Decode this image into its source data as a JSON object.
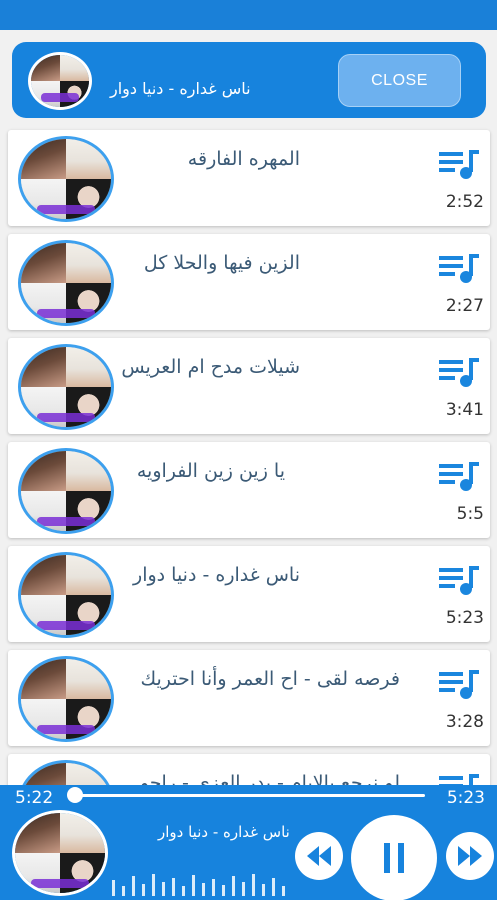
{
  "colors": {
    "brand": "#1783dd",
    "accent": "#3da0ee",
    "text": "#3b5a76"
  },
  "header": {
    "now_playing_title": "ناس غداره - دنيا دوار",
    "close_label": "CLOSE"
  },
  "songs": [
    {
      "title": "المهره الفارقه",
      "duration": "2:52"
    },
    {
      "title": "الزين فيها والحلا كل",
      "duration": "2:27"
    },
    {
      "title": "شيلات مدح ام العريس",
      "duration": "3:41"
    },
    {
      "title": "يا زين زين الفراويه",
      "duration": "5:5"
    },
    {
      "title": "ناس غداره - دنيا دوار",
      "duration": "5:23"
    },
    {
      "title": "فرصه لقى -  اح العمر وأنا احتريك",
      "duration": "3:28"
    },
    {
      "title": "لو نرجع بالايام - بدر العزي - راحو",
      "duration": ""
    }
  ],
  "player": {
    "current_time": "5:22",
    "total_time": "5:23",
    "progress": 0.0,
    "title": "ناس غداره - دنيا دوار",
    "icons": [
      "previous-icon",
      "pause-icon",
      "next-icon"
    ]
  }
}
